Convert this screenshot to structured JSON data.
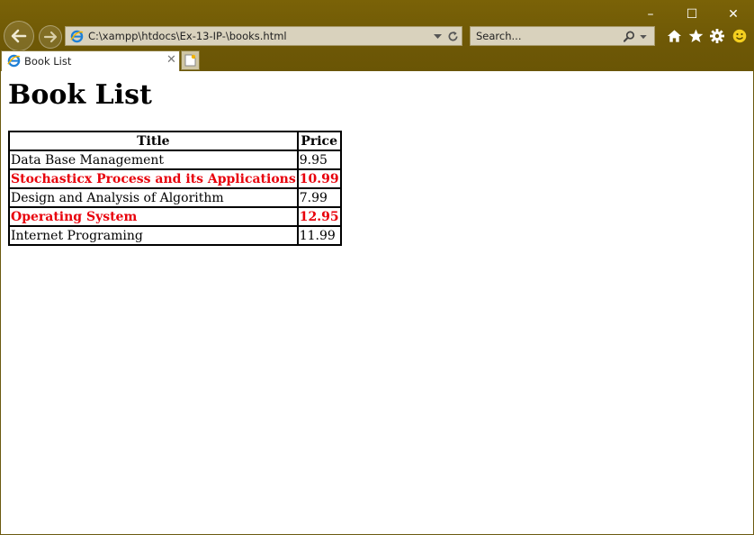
{
  "browser": {
    "address": "C:\\xampp\\htdocs\\Ex-13-IP-\\books.html",
    "search_placeholder": "Search...",
    "tab_title": "Book List",
    "window_buttons": {
      "minimize": "–",
      "maximize": "☐",
      "close": "✕"
    },
    "tab_close": "✕"
  },
  "page": {
    "heading": "Book List",
    "table": {
      "headers": {
        "title": "Title",
        "price": "Price"
      },
      "rows": [
        {
          "title": "Data Base Management",
          "price": "9.95",
          "highlight": false
        },
        {
          "title": "Stochasticx Process and its Applications",
          "price": "10.99",
          "highlight": true
        },
        {
          "title": "Design and Analysis of Algorithm",
          "price": "7.99",
          "highlight": false
        },
        {
          "title": "Operating System",
          "price": "12.95",
          "highlight": true
        },
        {
          "title": "Internet Programing",
          "price": "11.99",
          "highlight": false
        }
      ]
    }
  },
  "colors": {
    "chrome": "#6e5806",
    "highlight_text": "#e8000b"
  },
  "icons": [
    "back-icon",
    "forward-icon",
    "ie-logo-icon",
    "dropdown-icon",
    "refresh-icon",
    "search-icon",
    "home-icon",
    "favorites-star-icon",
    "settings-gear-icon",
    "smiley-feedback-icon",
    "new-tab-icon"
  ]
}
